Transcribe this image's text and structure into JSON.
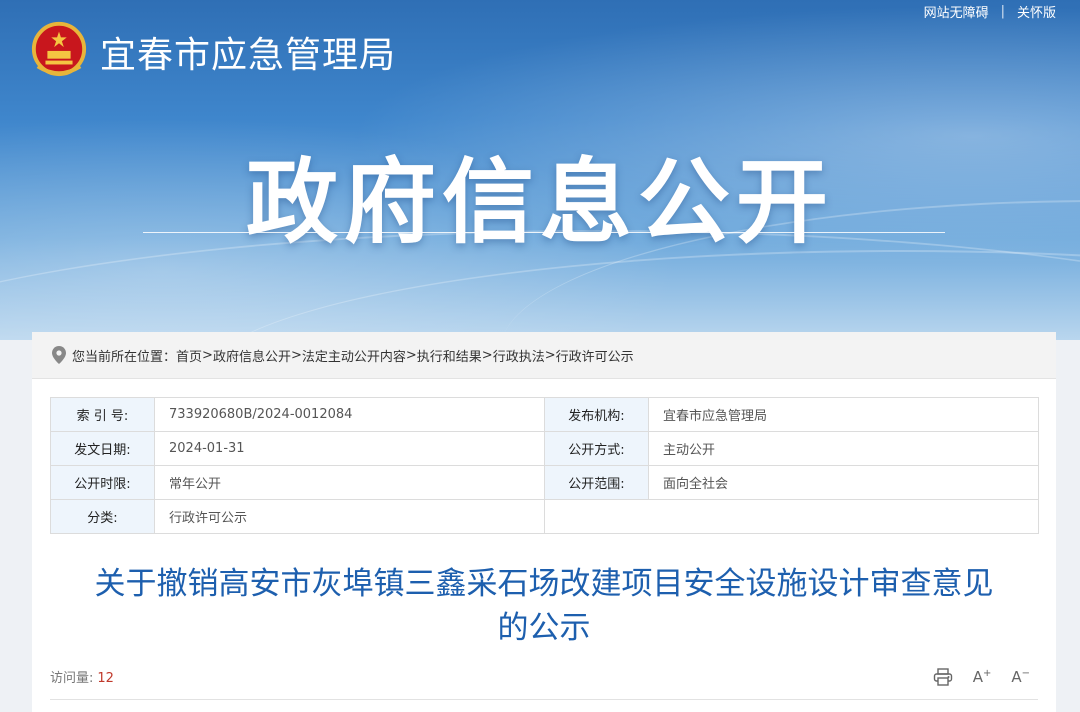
{
  "header": {
    "site_title": "宜春市应急管理局",
    "section_title": "政府信息公开",
    "top_links": [
      "网站无障碍",
      "关怀版"
    ]
  },
  "breadcrumb": {
    "prefix": "您当前所在位置：",
    "items": [
      "首页",
      "政府信息公开",
      "法定主动公开内容",
      "执行和结果",
      "行政执法",
      "行政许可公示"
    ],
    "separator": ">"
  },
  "info": {
    "rows": [
      {
        "l1": "索 引 号:",
        "v1": "733920680B/2024-0012084",
        "l2": "发布机构:",
        "v2": "宜春市应急管理局"
      },
      {
        "l1": "发文日期:",
        "v1": "2024-01-31",
        "l2": "公开方式:",
        "v2": "主动公开"
      },
      {
        "l1": "公开时限:",
        "v1": "常年公开",
        "l2": "公开范围:",
        "v2": "面向全社会"
      },
      {
        "l1": "分类:",
        "v1": "行政许可公示",
        "l2": "",
        "v2": ""
      }
    ]
  },
  "document": {
    "title_line1": "关于撤销高安市灰埠镇三鑫采石场改建项目安全设施设计审查意见",
    "title_line2": "的公示",
    "visits_label": "访问量:",
    "visits_count": "12"
  },
  "tools": {
    "increase_label": "A",
    "decrease_label": "A"
  },
  "colors": {
    "banner_top": "#2f6fb5",
    "title_blue": "#1d5fae",
    "label_bg": "#eef5fc",
    "visit_count": "#c0392b"
  }
}
